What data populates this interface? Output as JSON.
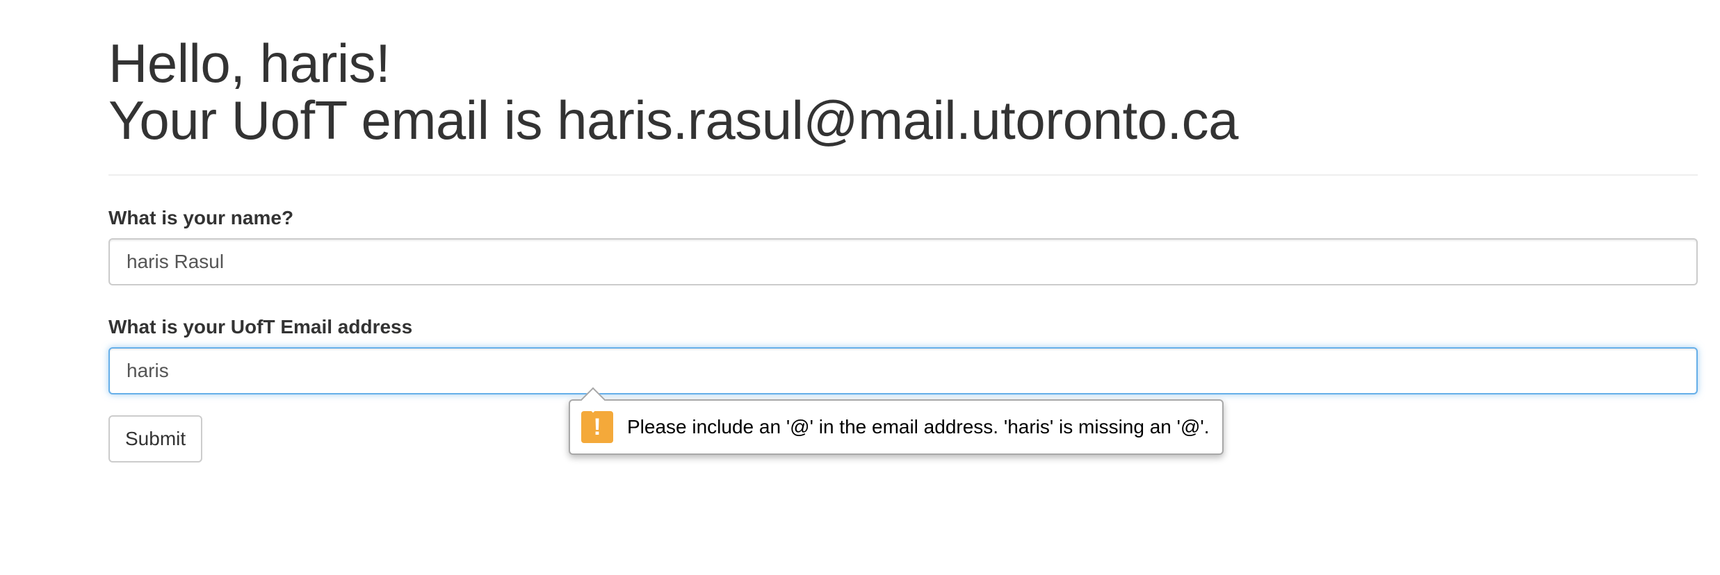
{
  "header": {
    "greeting": "Hello, haris!",
    "email_line": "Your UofT email is haris.rasul@mail.utoronto.ca"
  },
  "form": {
    "name_label": "What is your name?",
    "name_value": "haris Rasul",
    "email_label": "What is your UofT Email address",
    "email_value": "haris",
    "submit_label": "Submit"
  },
  "validation_tooltip": {
    "message": "Please include an '@' in the email address. 'haris' is missing an '@'.",
    "icon": "exclamation-icon",
    "icon_symbol": "!",
    "icon_color": "#f4a93a"
  },
  "colors": {
    "text": "#333333",
    "focus_border": "#66afe9"
  }
}
